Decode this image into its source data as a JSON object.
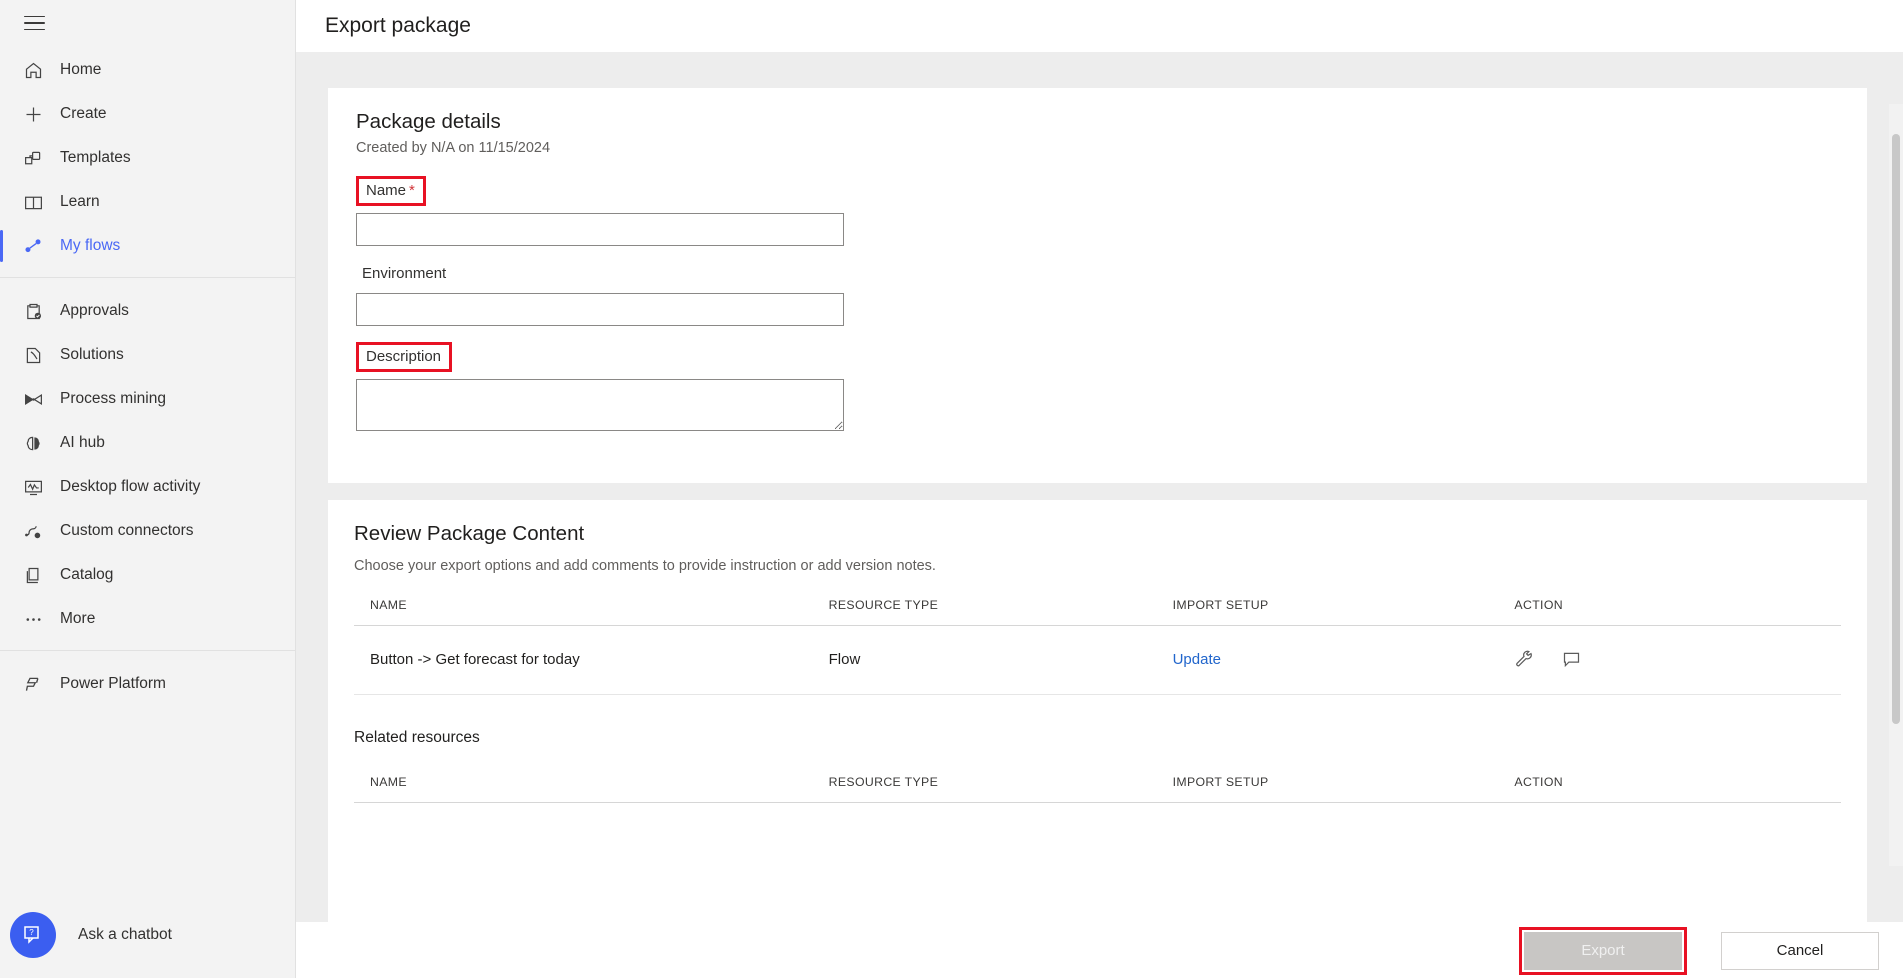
{
  "sidebar": {
    "hamburger_name": "global-nav-toggle",
    "primary_items": [
      {
        "label": "Home",
        "icon": "home-icon",
        "active": false
      },
      {
        "label": "Create",
        "icon": "plus-icon",
        "active": false
      },
      {
        "label": "Templates",
        "icon": "templates-icon",
        "active": false
      },
      {
        "label": "Learn",
        "icon": "book-icon",
        "active": false
      },
      {
        "label": "My flows",
        "icon": "flow-icon",
        "active": true
      }
    ],
    "secondary_items": [
      {
        "label": "Approvals",
        "icon": "clipboard-check-icon"
      },
      {
        "label": "Solutions",
        "icon": "solutions-icon"
      },
      {
        "label": "Process mining",
        "icon": "process-mining-icon"
      },
      {
        "label": "AI hub",
        "icon": "ai-brain-icon"
      },
      {
        "label": "Desktop flow activity",
        "icon": "monitor-activity-icon"
      },
      {
        "label": "Custom connectors",
        "icon": "custom-connector-icon"
      },
      {
        "label": "Catalog",
        "icon": "catalog-icon"
      },
      {
        "label": "More",
        "icon": "ellipsis-icon"
      }
    ],
    "footer_items": [
      {
        "label": "Power Platform",
        "icon": "power-platform-icon"
      }
    ],
    "chatbot": {
      "label": "Ask a chatbot",
      "icon": "chatbot-icon",
      "color": "#3b5ef0"
    },
    "active_accent": "#4a68f5"
  },
  "header": {
    "title": "Export package"
  },
  "package_details": {
    "title": "Package details",
    "created_text": "Created by N/A on 11/15/2024",
    "fields": [
      {
        "label": "Name",
        "required": true,
        "required_marker": "*",
        "value": "",
        "placeholder": "",
        "type": "text",
        "highlighted": true
      },
      {
        "label": "Environment",
        "required": false,
        "required_marker": "",
        "value": "",
        "placeholder": "",
        "type": "text",
        "highlighted": false
      },
      {
        "label": "Description",
        "required": false,
        "required_marker": "",
        "value": "",
        "placeholder": "",
        "type": "textarea",
        "highlighted": true
      }
    ]
  },
  "review_package": {
    "title": "Review Package Content",
    "description": "Choose your export options and add comments to provide instruction or add version notes.",
    "columns": [
      "NAME",
      "RESOURCE TYPE",
      "IMPORT SETUP",
      "ACTION"
    ],
    "rows": [
      {
        "name": "Button -> Get forecast for today",
        "resource_type": "Flow",
        "import_setup": "Update",
        "actions": [
          "wrench-icon",
          "comment-icon"
        ]
      }
    ],
    "related_title": "Related resources",
    "related_columns": [
      "NAME",
      "RESOURCE TYPE",
      "IMPORT SETUP",
      "ACTION"
    ],
    "related_rows": []
  },
  "footer": {
    "export_label": "Export",
    "export_disabled": true,
    "export_highlighted": true,
    "cancel_label": "Cancel"
  },
  "colors": {
    "highlight_box": "#e81123",
    "link": "#2266cc",
    "accent": "#4a68f5",
    "page_bg": "#ededed",
    "sidebar_bg": "#f3f3f3",
    "disabled_button": "#c8c6c4"
  }
}
